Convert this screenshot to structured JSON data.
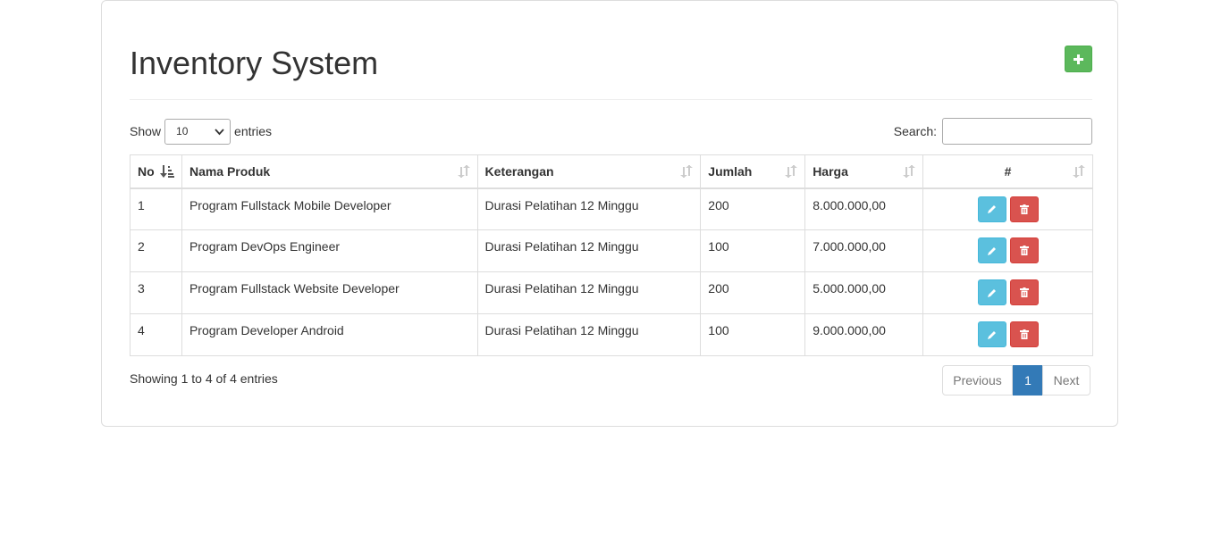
{
  "page": {
    "title": "Inventory System",
    "add_button_icon": "plus-icon"
  },
  "controls": {
    "show_label": "Show",
    "entries_label": "entries",
    "length_value": "10",
    "search_label": "Search:",
    "search_value": ""
  },
  "table": {
    "columns": [
      "No",
      "Nama Produk",
      "Keterangan",
      "Jumlah",
      "Harga",
      "#"
    ],
    "rows": [
      {
        "no": "1",
        "nama": "Program Fullstack Mobile Developer",
        "keterangan": "Durasi Pelatihan 12 Minggu",
        "jumlah": "200",
        "harga": "8.000.000,00"
      },
      {
        "no": "2",
        "nama": "Program DevOps Engineer",
        "keterangan": "Durasi Pelatihan 12 Minggu",
        "jumlah": "100",
        "harga": "7.000.000,00"
      },
      {
        "no": "3",
        "nama": "Program Fullstack Website Developer",
        "keterangan": "Durasi Pelatihan 12 Minggu",
        "jumlah": "200",
        "harga": "5.000.000,00"
      },
      {
        "no": "4",
        "nama": "Program Developer Android",
        "keterangan": "Durasi Pelatihan 12 Minggu",
        "jumlah": "100",
        "harga": "9.000.000,00"
      }
    ]
  },
  "footer": {
    "info": "Showing 1 to 4 of 4 entries",
    "previous": "Previous",
    "current_page": "1",
    "next": "Next"
  },
  "colors": {
    "add_button": "#5cb85c",
    "edit_button": "#5bc0de",
    "delete_button": "#d9534f",
    "active_page": "#337ab7"
  }
}
